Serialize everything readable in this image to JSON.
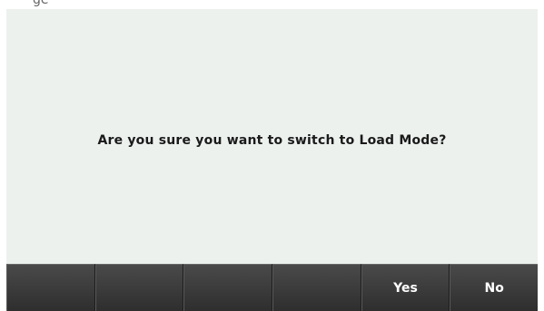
{
  "top_strip": {
    "clipped_text": "ge"
  },
  "dialog": {
    "message": "Are you sure you want to switch to Load Mode?"
  },
  "softkeys": [
    {
      "label": ""
    },
    {
      "label": ""
    },
    {
      "label": ""
    },
    {
      "label": ""
    },
    {
      "label": "Yes"
    },
    {
      "label": "No"
    }
  ],
  "colors": {
    "screen_bg": "#ecf1ee",
    "softkey_bg": "#3b3b3b",
    "softkey_text": "#ffffff",
    "message_text": "#1a1a1a"
  }
}
